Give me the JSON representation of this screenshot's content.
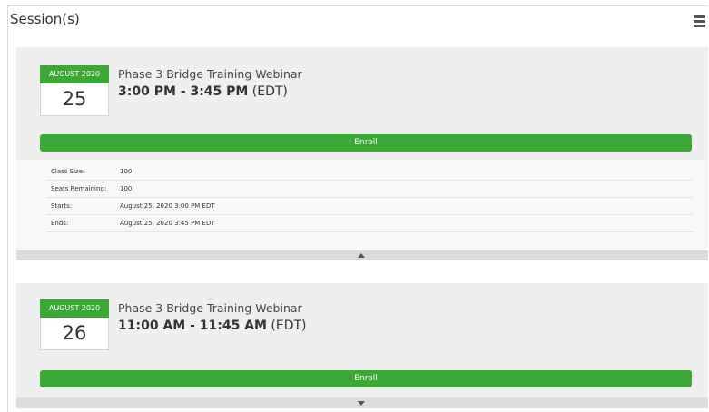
{
  "panel": {
    "title": "Session(s)"
  },
  "sessions": [
    {
      "month": "AUGUST 2020",
      "day": "25",
      "name": "Phase 3 Bridge Training Webinar",
      "time": "3:00 PM - 3:45 PM",
      "timezone": "(EDT)",
      "enroll_label": "Enroll",
      "details": [
        {
          "label": "Class Size:",
          "value": "100"
        },
        {
          "label": "Seats Remaining:",
          "value": "100"
        },
        {
          "label": "Starts:",
          "value": "August 25, 2020 3:00 PM EDT"
        },
        {
          "label": "Ends:",
          "value": "August 25, 2020 3:45 PM EDT"
        }
      ],
      "details_expanded": true
    },
    {
      "month": "AUGUST 2020",
      "day": "26",
      "name": "Phase 3 Bridge Training Webinar",
      "time": "11:00 AM - 11:45 AM",
      "timezone": "(EDT)",
      "enroll_label": "Enroll",
      "details_expanded": false
    }
  ],
  "icons": {
    "menu": "hamburger-icon",
    "collapse": "chevron-up-icon",
    "expand": "chevron-down-icon"
  },
  "colors": {
    "accent_green": "#3aaa35",
    "session_bg": "#efefef",
    "details_bg": "#f7f7f7",
    "toggle_bg": "#dcdcdc"
  }
}
